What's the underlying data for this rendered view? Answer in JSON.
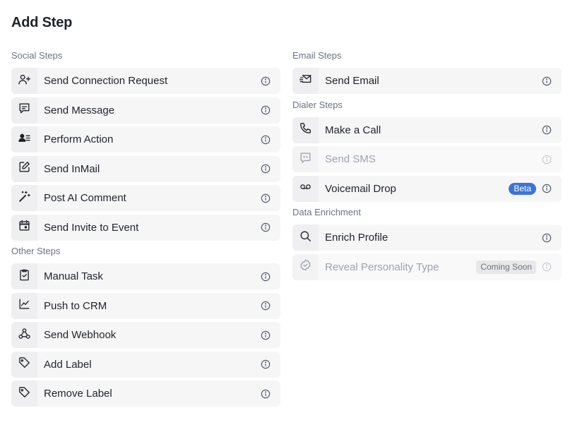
{
  "title": "Add Step",
  "left_sections": [
    {
      "label": "Social Steps",
      "steps": [
        {
          "label": "Send Connection Request",
          "icon": "user-plus-icon"
        },
        {
          "label": "Send Message",
          "icon": "message-square-icon"
        },
        {
          "label": "Perform Action",
          "icon": "user-list-icon"
        },
        {
          "label": "Send InMail",
          "icon": "edit-square-icon"
        },
        {
          "label": "Post AI Comment",
          "icon": "magic-wand-icon"
        },
        {
          "label": "Send Invite to Event",
          "icon": "calendar-icon"
        }
      ]
    },
    {
      "label": "Other Steps",
      "steps": [
        {
          "label": "Manual Task",
          "icon": "clipboard-check-icon"
        },
        {
          "label": "Push to CRM",
          "icon": "line-chart-icon"
        },
        {
          "label": "Send Webhook",
          "icon": "webhook-icon"
        },
        {
          "label": "Add Label",
          "icon": "tag-icon"
        },
        {
          "label": "Remove Label",
          "icon": "tag-icon"
        }
      ]
    }
  ],
  "right_sections": [
    {
      "label": "Email Steps",
      "steps": [
        {
          "label": "Send Email",
          "icon": "mail-send-icon"
        }
      ]
    },
    {
      "label": "Dialer Steps",
      "steps": [
        {
          "label": "Make a Call",
          "icon": "phone-icon"
        },
        {
          "label": "Send SMS",
          "icon": "sms-icon",
          "disabled": true
        },
        {
          "label": "Voicemail Drop",
          "icon": "voicemail-icon",
          "badge": "Beta"
        }
      ]
    },
    {
      "label": "Data Enrichment",
      "steps": [
        {
          "label": "Enrich Profile",
          "icon": "search-icon"
        },
        {
          "label": "Reveal Personality Type",
          "icon": "badge-check-icon",
          "disabled": true,
          "badge": "Coming Soon"
        }
      ]
    }
  ],
  "colors": {
    "beta_badge": "#3b73d9",
    "row_background": "#f6f6f7"
  }
}
